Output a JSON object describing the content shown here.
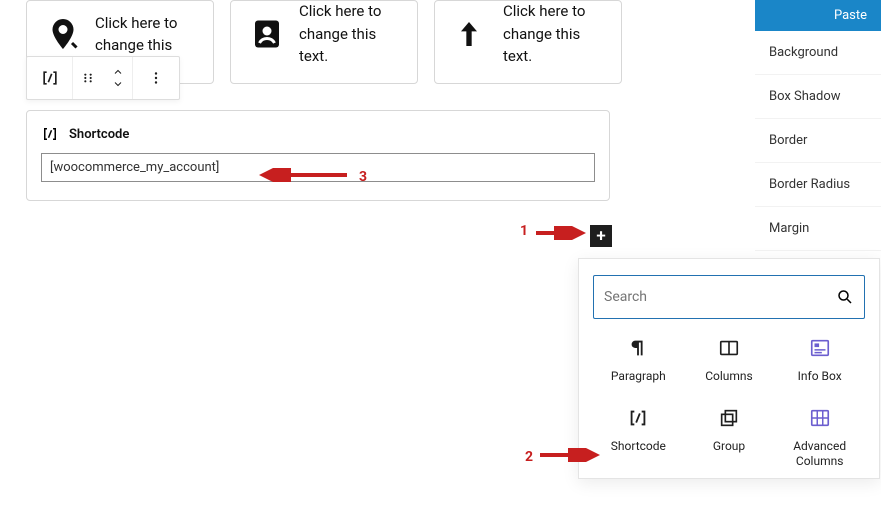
{
  "features": [
    {
      "text": "Click here to change this"
    },
    {
      "text": "Click here to change this text."
    },
    {
      "text": "Click here to change this text."
    }
  ],
  "shortcode": {
    "label": "Shortcode",
    "value": "[woocommerce_my_account]"
  },
  "sidebar": {
    "paste": "Paste",
    "items": [
      "Background",
      "Box Shadow",
      "Border",
      "Border Radius",
      "Margin"
    ]
  },
  "inserter": {
    "search_placeholder": "Search",
    "blocks": [
      "Paragraph",
      "Columns",
      "Info Box",
      "Shortcode",
      "Group",
      "Advanced Columns"
    ]
  },
  "annotations": {
    "a1": "1",
    "a2": "2",
    "a3": "3"
  }
}
